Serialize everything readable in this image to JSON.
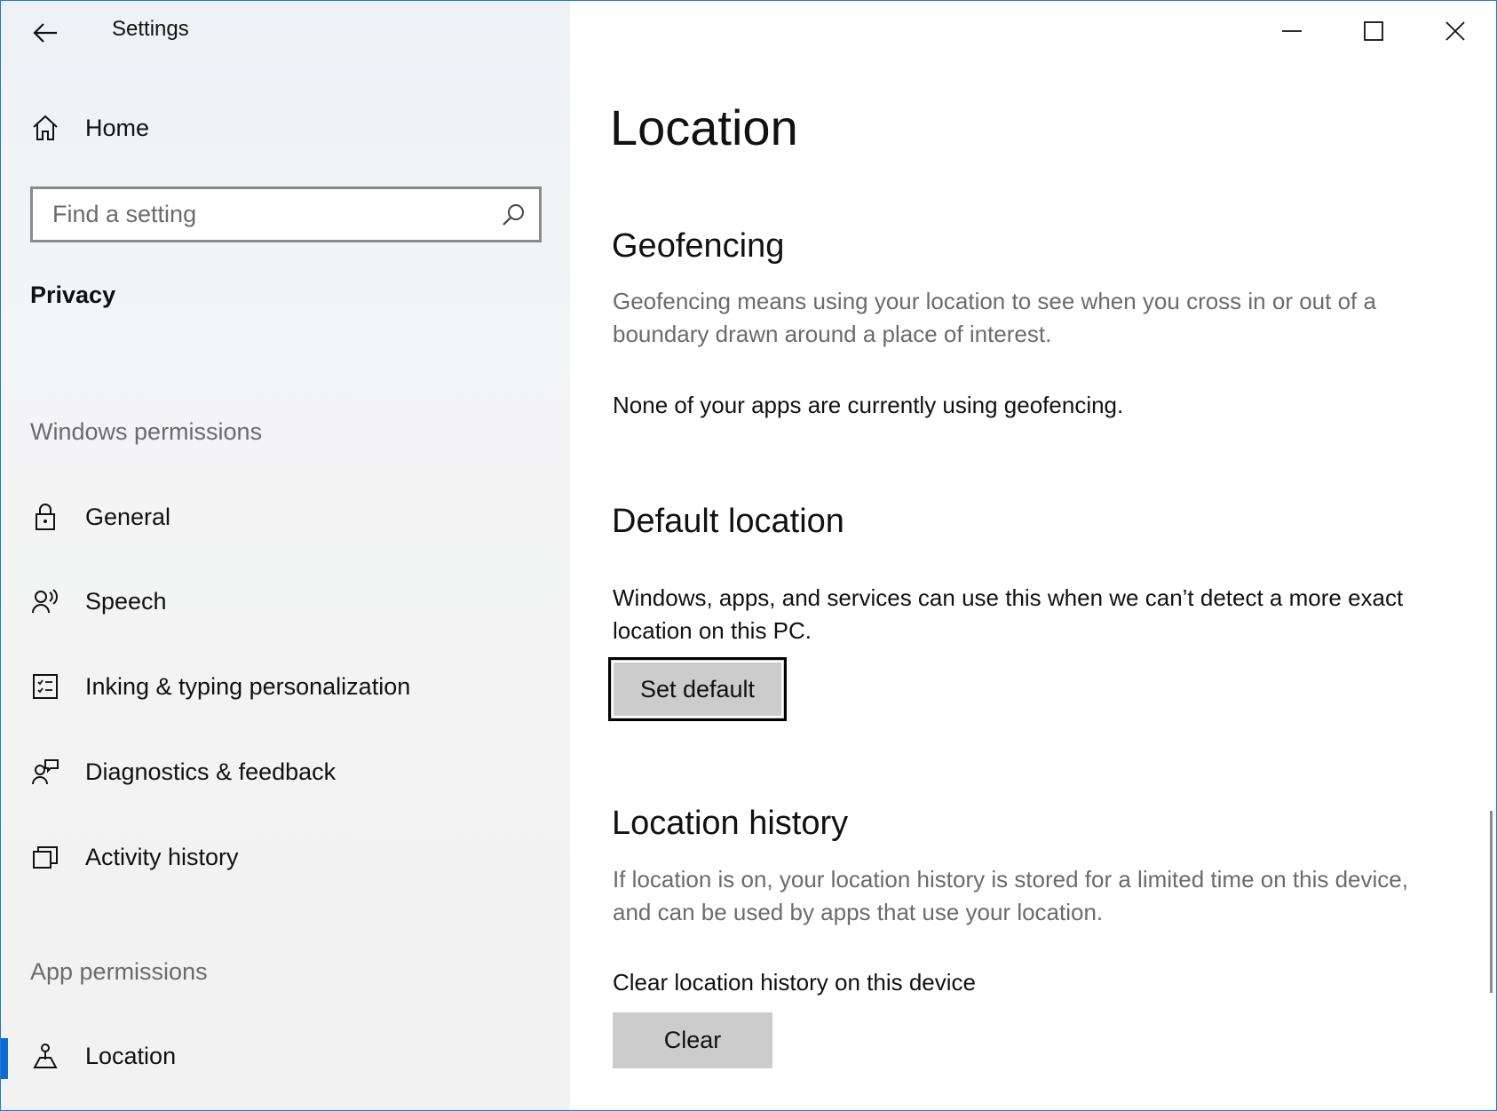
{
  "window": {
    "title": "Settings",
    "controls": [
      "minimize-icon",
      "maximize-icon",
      "close-icon"
    ],
    "accent_color": "#0a6cd1"
  },
  "sidebar": {
    "home_label": "Home",
    "search_placeholder": "Find a setting",
    "category": "Privacy",
    "windows_permissions_header": "Windows permissions",
    "windows_items": [
      {
        "label": "General",
        "icon": "lock-icon"
      },
      {
        "label": "Speech",
        "icon": "speech-icon"
      },
      {
        "label": "Inking & typing personalization",
        "icon": "inking-icon"
      },
      {
        "label": "Diagnostics & feedback",
        "icon": "feedback-icon"
      },
      {
        "label": "Activity history",
        "icon": "activity-icon"
      }
    ],
    "app_permissions_header": "App permissions",
    "app_items": [
      {
        "label": "Location",
        "icon": "location-icon",
        "selected": true
      }
    ]
  },
  "main": {
    "page_title": "Location",
    "geofencing": {
      "title": "Geofencing",
      "description": "Geofencing means using your location to see when you cross in or out of a boundary drawn around a place of interest.",
      "status": "None of your apps are currently using geofencing."
    },
    "default_location": {
      "title": "Default location",
      "description": "Windows, apps, and services can use this when we can’t detect a more exact location on this PC.",
      "button_label": "Set default"
    },
    "location_history": {
      "title": "Location history",
      "description": "If location is on, your location history is stored for a limited time on this device, and can be used by apps that use your location.",
      "clear_label": "Clear location history on this device",
      "button_label": "Clear"
    }
  }
}
